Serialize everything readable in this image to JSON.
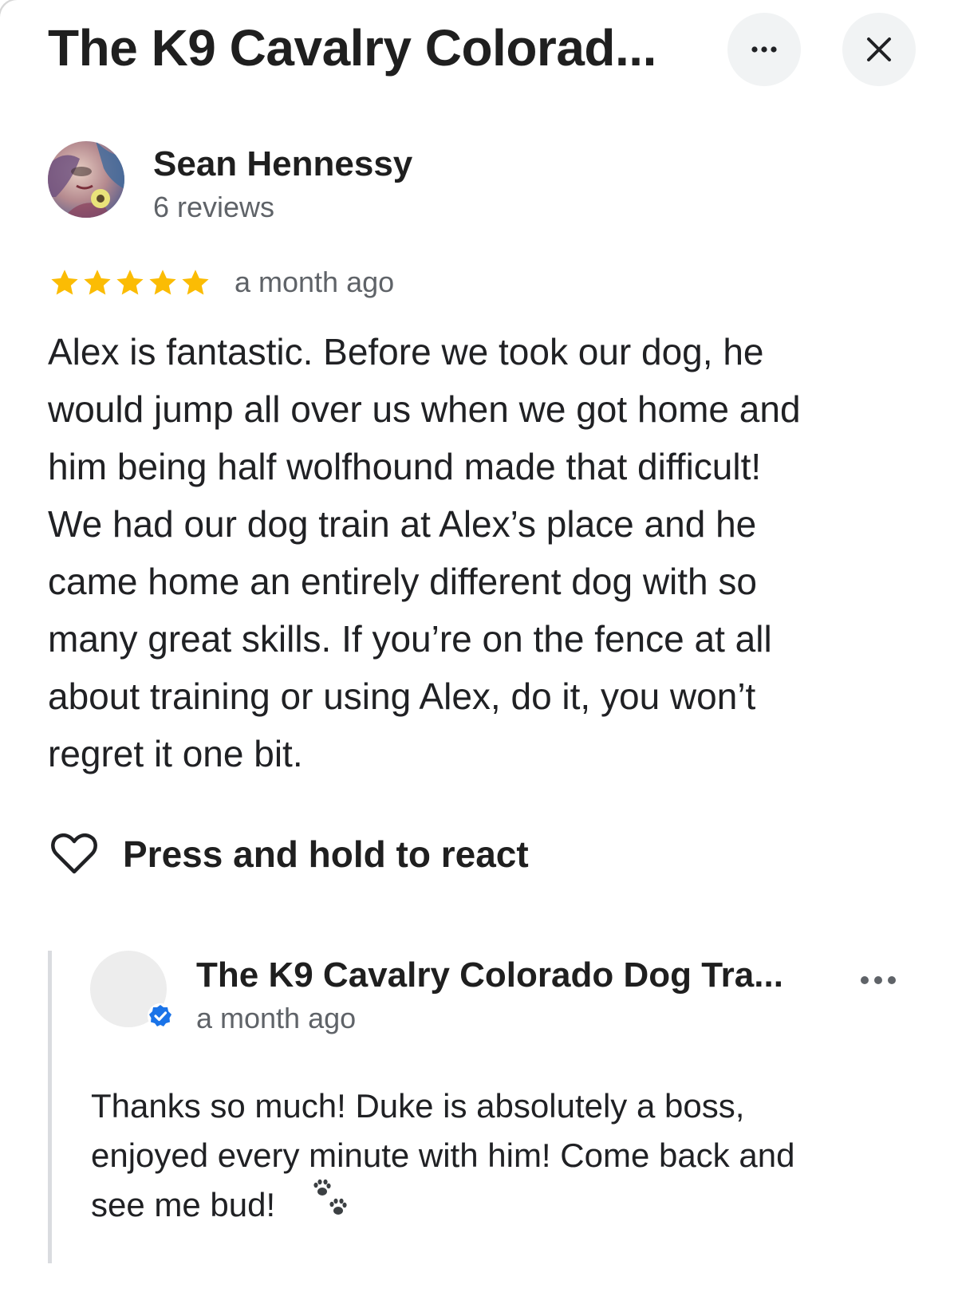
{
  "header": {
    "title": "The K9 Cavalry Colorad...",
    "more_icon": "more-horizontal-icon",
    "close_icon": "close-icon"
  },
  "review": {
    "author": "Sean Hennessy",
    "author_reviews": "6 reviews",
    "rating": 5,
    "rating_max": 5,
    "star_color": "#fbbc04",
    "date": "a month ago",
    "text": "Alex is fantastic. Before we took our dog, he\nwould jump all over us when we got home and\nhim being half wolfhound made that difficult!\nWe had our dog train at Alex’s place and he\ncame home an entirely different dog with so\nmany great skills. If you’re on the fence at all\nabout training or using Alex, do it, you won’t\nregret it one bit.",
    "react_label": "Press and hold to react",
    "react_icon": "heart-outline-icon"
  },
  "owner_response": {
    "name": "The K9 Cavalry Colorado Dog Tra...",
    "verified_color": "#1a73e8",
    "date": "a month ago",
    "text": "Thanks so much!  Duke is absolutely a boss,\nenjoyed every minute with him!  Come back and\nsee me bud!",
    "emoji_icon": "paw-prints-icon"
  }
}
